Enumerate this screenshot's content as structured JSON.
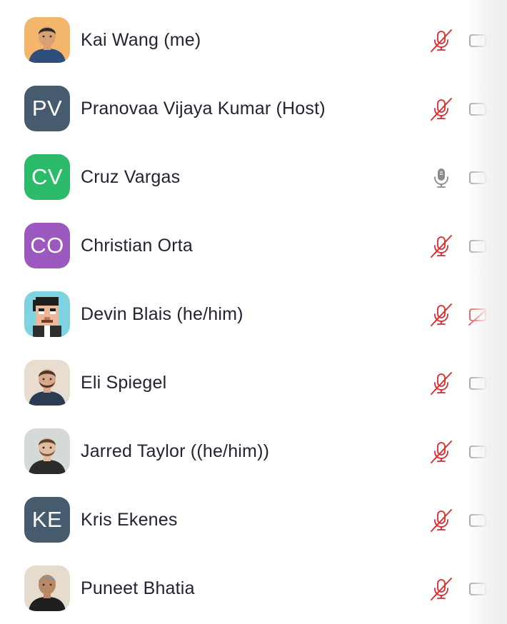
{
  "colors": {
    "muted_red": "#e02828",
    "icon_gray": "#8a8a8f",
    "name_text": "#232333"
  },
  "participants": [
    {
      "name": "Kai Wang (me)",
      "avatar_type": "photo",
      "initials": "",
      "avatar_color": "#f2a65a",
      "mic": "muted",
      "video": "on",
      "mic_icon": "mic-muted-icon",
      "cam_icon": "camera-icon"
    },
    {
      "name": "Pranovaa Vijaya Kumar (Host)",
      "avatar_type": "initials",
      "initials": "PV",
      "avatar_color": "#475b6e",
      "mic": "muted",
      "video": "on",
      "mic_icon": "mic-muted-icon",
      "cam_icon": "camera-icon"
    },
    {
      "name": "Cruz Vargas",
      "avatar_type": "initials",
      "initials": "CV",
      "avatar_color": "#2bbb6a",
      "mic": "unmuted",
      "video": "on",
      "mic_icon": "mic-icon",
      "cam_icon": "camera-icon"
    },
    {
      "name": "Christian Orta",
      "avatar_type": "initials",
      "initials": "CO",
      "avatar_color": "#9b59c0",
      "mic": "muted",
      "video": "on",
      "mic_icon": "mic-muted-icon",
      "cam_icon": "camera-icon"
    },
    {
      "name": "Devin Blais (he/him)",
      "avatar_type": "pixel-art",
      "initials": "",
      "avatar_color": "#7fd3e0",
      "mic": "muted",
      "video": "off",
      "mic_icon": "mic-muted-icon",
      "cam_icon": "camera-off-icon"
    },
    {
      "name": "Eli Spiegel",
      "avatar_type": "photo",
      "initials": "",
      "avatar_color": "#c9b8a6",
      "mic": "muted",
      "video": "on",
      "mic_icon": "mic-muted-icon",
      "cam_icon": "camera-icon"
    },
    {
      "name": "Jarred Taylor ((he/him))",
      "avatar_type": "photo",
      "initials": "",
      "avatar_color": "#cfd3cf",
      "mic": "muted",
      "video": "on",
      "mic_icon": "mic-muted-icon",
      "cam_icon": "camera-icon"
    },
    {
      "name": "Kris Ekenes",
      "avatar_type": "initials",
      "initials": "KE",
      "avatar_color": "#475b6e",
      "mic": "muted",
      "video": "on",
      "mic_icon": "mic-muted-icon",
      "cam_icon": "camera-icon"
    },
    {
      "name": "Puneet Bhatia",
      "avatar_type": "photo",
      "initials": "",
      "avatar_color": "#d9c9b3",
      "mic": "muted",
      "video": "on",
      "mic_icon": "mic-muted-icon",
      "cam_icon": "camera-icon"
    }
  ]
}
